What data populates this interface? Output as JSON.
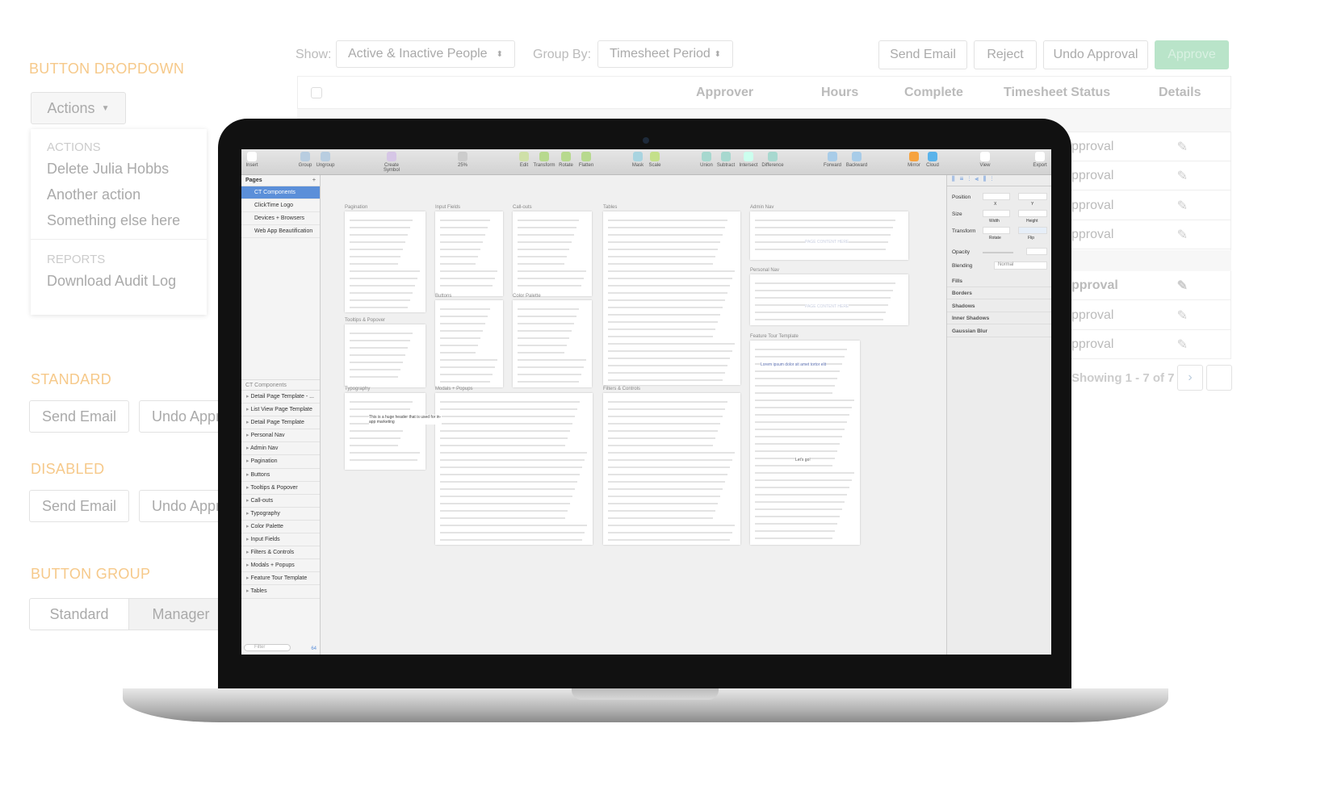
{
  "left": {
    "button_dropdown_title": "BUTTON DROPDOWN",
    "actions_label": "Actions",
    "menu": {
      "header1": "ACTIONS",
      "items1": [
        "Delete Julia Hobbs",
        "Another action",
        "Something else here"
      ],
      "header2": "REPORTS",
      "items2": [
        "Download Audit Log"
      ]
    },
    "standard_title": "STANDARD",
    "disabled_title": "DISABLED",
    "send_email": "Send Email",
    "undo_approval": "Undo Approval",
    "button_group_title": "BUTTON GROUP",
    "group": [
      "Standard",
      "Manager"
    ]
  },
  "top": {
    "show_label": "Show:",
    "show_value": "Active & Inactive People",
    "group_by_label": "Group By:",
    "group_by_value": "Timesheet Period",
    "buttons": [
      "Send Email",
      "Reject",
      "Undo Approval",
      "Approve"
    ],
    "approve_color": "#b9e4c9"
  },
  "table": {
    "headers": [
      "Approver",
      "Hours",
      "Complete",
      "Timesheet Status",
      "Details"
    ],
    "status_rows": [
      "pproval",
      "pproval",
      "pproval",
      "pproval",
      "pproval",
      "pproval",
      "pproval"
    ],
    "pagination": "Showing 1 - 7 of 7",
    "next": "›"
  },
  "sketch": {
    "toolbar": [
      "Insert",
      "Group",
      "Ungroup",
      "Create Symbol",
      "25%",
      "Edit",
      "Transform",
      "Rotate",
      "Flatten",
      "Mask",
      "Scale",
      "Union",
      "Subtract",
      "Intersect",
      "Difference",
      "Forward",
      "Backward",
      "Mirror",
      "Cloud",
      "View",
      "Export"
    ],
    "pages_title": "Pages",
    "pages": [
      "CT Components",
      "ClickTime Logo",
      "Devices + Browsers",
      "Web App Beautification"
    ],
    "layers_title": "CT Components",
    "layers": [
      "Detail Page Template - ...",
      "List View Page Template",
      "Detail Page Template",
      "Personal Nav",
      "Admin Nav",
      "Pagination",
      "Buttons",
      "Tooltips & Popover",
      "Call-outs",
      "Typography",
      "Color Palette",
      "Input Fields",
      "Filters & Controls",
      "Modals + Popups",
      "Feature Tour Template",
      "Tables"
    ],
    "filter_placeholder": "Filter",
    "filter_count": "64",
    "artboards": [
      "Pagination",
      "Input Fields",
      "Call-outs",
      "Tables",
      "Admin Nav",
      "Personal Nav",
      "Tooltips & Popover",
      "Buttons",
      "Color Palette",
      "Feature Tour Template",
      "Typography",
      "Modals + Popups",
      "Filters & Controls"
    ],
    "artboard_texts": {
      "admin_nav": "PAGE CONTENT HERE",
      "personal_nav": "PAGE CONTENT HERE",
      "tour": "Lorem ipsum dolor sit amet tortor elit",
      "lets_go": "Let's go!",
      "typo": "This is a huge header that is used for in-app marketing"
    },
    "inspector": {
      "position": "Position",
      "x": "X",
      "y": "Y",
      "size": "Size",
      "width": "Width",
      "height": "Height",
      "transform": "Transform",
      "rotate": "Rotate",
      "flip": "Flip",
      "opacity": "Opacity",
      "blending": "Blending",
      "blending_value": "Normal",
      "sections": [
        "Fills",
        "Borders",
        "Shadows",
        "Inner Shadows",
        "Gaussian Blur"
      ]
    }
  }
}
